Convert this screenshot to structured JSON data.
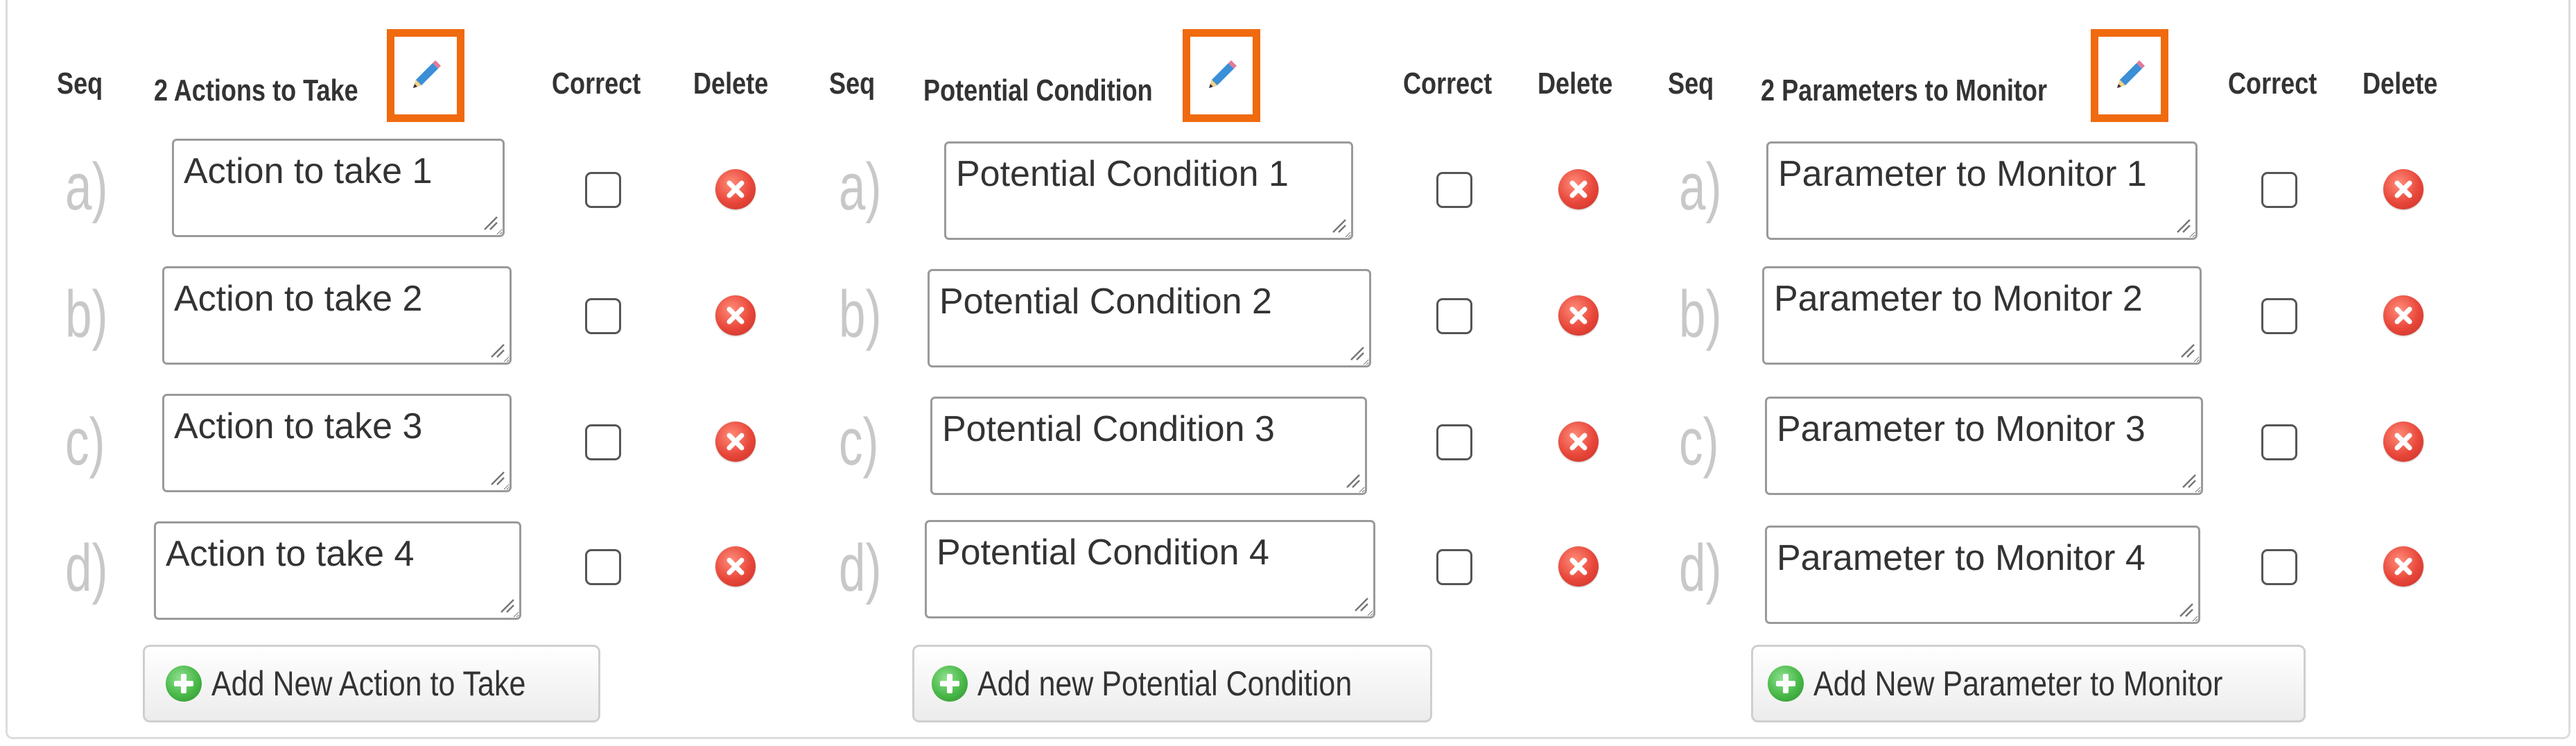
{
  "columns": [
    {
      "seq_header": "Seq",
      "title": "2 Actions to Take",
      "correct_header": "Correct",
      "delete_header": "Delete",
      "rows": [
        {
          "seq": "a)",
          "value": "Action to take 1",
          "correct": false
        },
        {
          "seq": "b)",
          "value": "Action to take 2",
          "correct": false
        },
        {
          "seq": "c)",
          "value": "Action to take 3",
          "correct": false
        },
        {
          "seq": "d)",
          "value": "Action to take 4",
          "correct": false
        }
      ],
      "add_label": "Add New Action to Take"
    },
    {
      "seq_header": "Seq",
      "title": "Potential Condition",
      "correct_header": "Correct",
      "delete_header": "Delete",
      "rows": [
        {
          "seq": "a)",
          "value": "Potential Condition 1",
          "correct": false
        },
        {
          "seq": "b)",
          "value": "Potential Condition 2",
          "correct": false
        },
        {
          "seq": "c)",
          "value": "Potential Condition 3",
          "correct": false
        },
        {
          "seq": "d)",
          "value": "Potential Condition 4",
          "correct": false
        }
      ],
      "add_label": "Add new Potential Condition"
    },
    {
      "seq_header": "Seq",
      "title": "2 Parameters to Monitor",
      "correct_header": "Correct",
      "delete_header": "Delete",
      "rows": [
        {
          "seq": "a)",
          "value": "Parameter to Monitor 1",
          "correct": false
        },
        {
          "seq": "b)",
          "value": "Parameter to Monitor 2",
          "correct": false
        },
        {
          "seq": "c)",
          "value": "Parameter to Monitor 3",
          "correct": false
        },
        {
          "seq": "d)",
          "value": "Parameter to Monitor 4",
          "correct": false
        }
      ],
      "add_label": "Add New Parameter to Monitor"
    }
  ],
  "icons": {
    "edit": "pencil-icon",
    "delete": "delete-circle-icon",
    "add": "plus-circle-icon"
  },
  "colors": {
    "highlight": "#f06a0f",
    "delete": "#e8473a",
    "add": "#48b848",
    "seq_letter": "#c8c8c8"
  }
}
